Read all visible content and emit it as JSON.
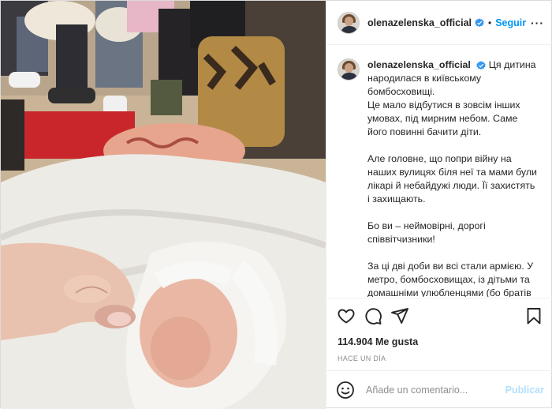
{
  "post": {
    "username": "olenazelenska_official",
    "follow_label": "Seguir",
    "separator": "•",
    "more_label": "···",
    "caption_paragraphs": [
      "Ця дитина народилася в київському бомбосховищі.",
      "Це мало відбутися в зовсім інших умовах, під мирним небом. Саме його повинні бачити діти.",
      "Але головне, що попри війну на наших вулицях біля неї та мами були лікарі й небайдужі люди. Її захистять і захищають.",
      "Бо ви – неймовірні, дорогі співвітчизники!",
      "За ці дві доби ви всі стали армією. У метро, бомбосховищах, із дітьми та домашніми улюбленцями (бо братів менших ви теж не покидаєте) – ви"
    ],
    "likes_text": "114.904 Me gusta",
    "time_text": "HACE UN DÍA"
  },
  "comment": {
    "placeholder": "Añade un comentario...",
    "publish_label": "Publicar"
  },
  "icons": {
    "verified": "verified-badge-icon",
    "like": "heart-icon",
    "comment": "comment-icon",
    "share": "paper-plane-icon",
    "save": "bookmark-icon",
    "emoji": "smiley-icon"
  },
  "colors": {
    "link_blue": "#0095f6",
    "publish_disabled": "#b2dffc",
    "verified": "#3897f0",
    "text": "#262626",
    "muted": "#8e8e8e"
  }
}
